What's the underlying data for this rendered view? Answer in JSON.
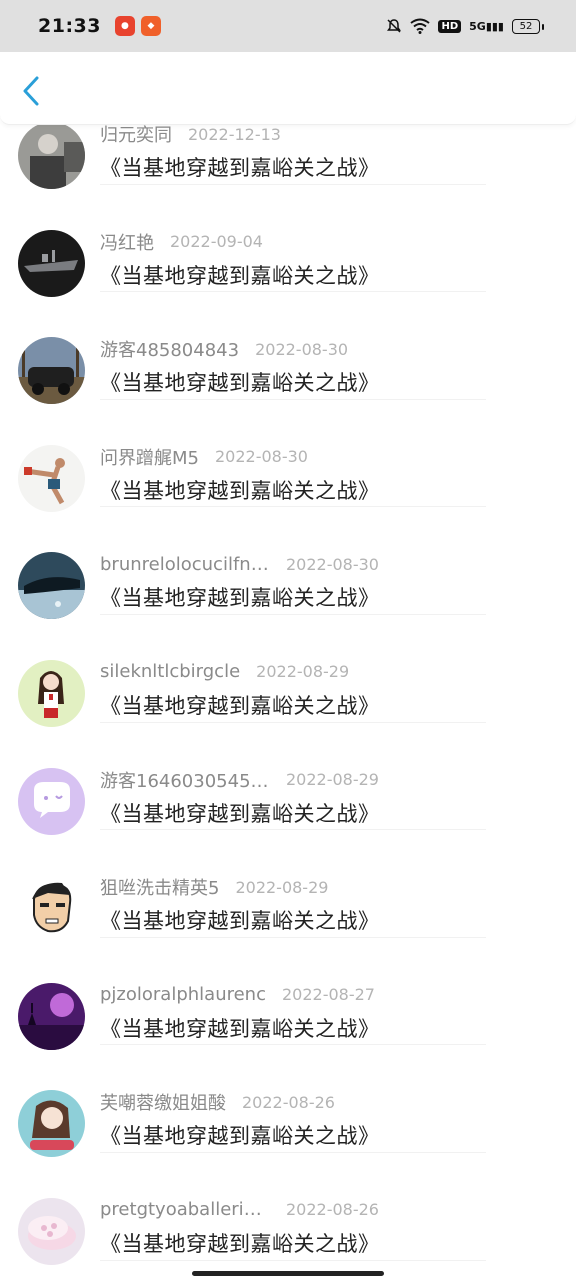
{
  "status_bar": {
    "time": "21:33",
    "hd_label": "HD",
    "signal_label": "5G",
    "battery_level": "52",
    "icons": [
      "app-badge-1-icon",
      "app-badge-2-icon",
      "mute-bell-icon",
      "wifi-icon",
      "hd-icon",
      "signal-5g-icon",
      "battery-icon"
    ]
  },
  "nav": {
    "back_icon": "chevron-left-icon",
    "accent_color": "#2a9fd8"
  },
  "list": {
    "items": [
      {
        "username": "归元奕同",
        "date": "2022-12-13",
        "title": "《当基地穿越到嘉峪关之战》"
      },
      {
        "username": "冯红艳",
        "date": "2022-09-04",
        "title": "《当基地穿越到嘉峪关之战》"
      },
      {
        "username": "游客485804843",
        "date": "2022-08-30",
        "title": "《当基地穿越到嘉峪关之战》"
      },
      {
        "username": "问界蹭艉M5",
        "date": "2022-08-30",
        "title": "《当基地穿越到嘉峪关之战》"
      },
      {
        "username": "brunrelolocucilfne...",
        "date": "2022-08-30",
        "title": "《当基地穿越到嘉峪关之战》"
      },
      {
        "username": "sileknltlcbirgcle",
        "date": "2022-08-29",
        "title": "《当基地穿越到嘉峪关之战》"
      },
      {
        "username": "游客16460305456...",
        "date": "2022-08-29",
        "title": "《当基地穿越到嘉峪关之战》"
      },
      {
        "username": "狙咝洗击精英5",
        "date": "2022-08-29",
        "title": "《当基地穿越到嘉峪关之战》"
      },
      {
        "username": "pjzoloralphlaurenc",
        "date": "2022-08-27",
        "title": "《当基地穿越到嘉峪关之战》"
      },
      {
        "username": "芙嘲蓉缴姐姐酸",
        "date": "2022-08-26",
        "title": "《当基地穿越到嘉峪关之战》"
      },
      {
        "username": "pretgtyoaballerina...",
        "date": "2022-08-26",
        "title": "《当基地穿越到嘉峪关之战》"
      }
    ]
  }
}
